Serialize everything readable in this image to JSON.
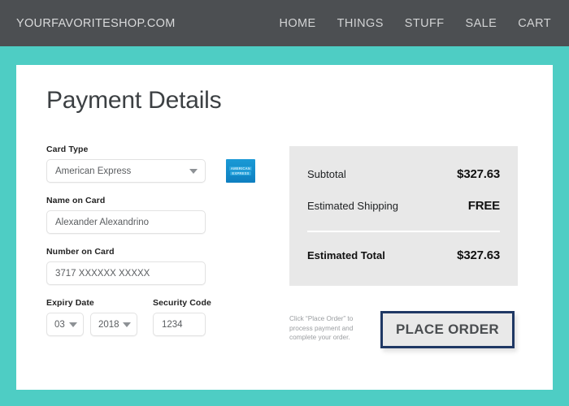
{
  "theme": {
    "accent_teal": "#4ECDC4",
    "nav_bg": "#4c4f52",
    "panel_gray": "#e8e8e8",
    "button_border": "#1f3864",
    "amex_blue": "#1a9ad6"
  },
  "navbar": {
    "brand": "YOURFAVORITESHOP.COM",
    "links": [
      {
        "label": "HOME"
      },
      {
        "label": "THINGS"
      },
      {
        "label": "STUFF"
      },
      {
        "label": "SALE"
      },
      {
        "label": "CART"
      }
    ]
  },
  "page_title": "Payment Details",
  "form": {
    "card_type": {
      "label": "Card Type",
      "value": "American Express",
      "icon": "chevron-down-icon",
      "logo_lines": [
        "AMERICAN",
        "EXPRESS"
      ]
    },
    "name_on_card": {
      "label": "Name on Card",
      "value": "Alexander Alexandrino"
    },
    "number_on_card": {
      "label": "Number on Card",
      "value": "3717 XXXXXX XXXXX"
    },
    "expiry": {
      "label": "Expiry Date",
      "month": "03",
      "year": "2018"
    },
    "security_code": {
      "label": "Security Code",
      "value": "1234"
    }
  },
  "summary": {
    "subtotal_label": "Subtotal",
    "subtotal_value": "$327.63",
    "shipping_label": "Estimated Shipping",
    "shipping_value": "FREE",
    "total_label": "Estimated Total",
    "total_value": "$327.63"
  },
  "order": {
    "helper_text": "Click “Place Order” to process payment and complete your order.",
    "button_label": "PLACE ORDER"
  }
}
